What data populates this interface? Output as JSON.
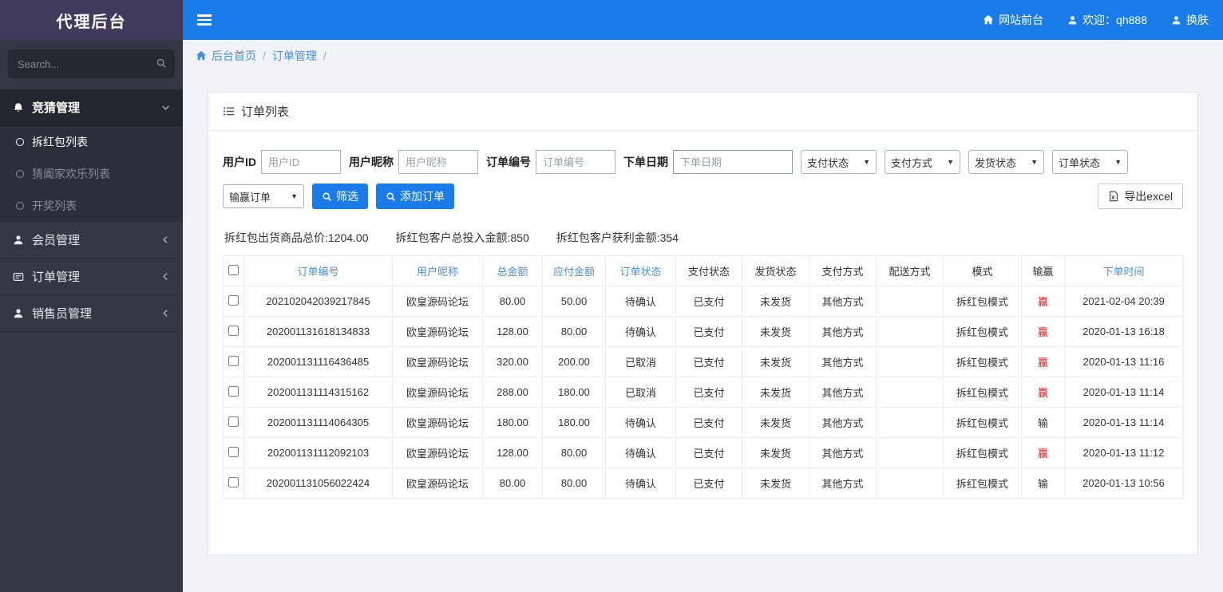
{
  "colors": {
    "accent": "#1a7ce8",
    "brand_bg": "#423a5c",
    "sidebar_bg": "#343845",
    "header_link": "#4a90d9",
    "win": "#e8161d"
  },
  "app": {
    "title": "代理后台"
  },
  "topbar": {
    "site_link": "网站前台",
    "welcome": "欢迎：qh888",
    "skin": "换肤"
  },
  "sidebar": {
    "search_placeholder": "Search...",
    "group": {
      "label": "竞猜管理"
    },
    "subitems": [
      {
        "label": "拆红包列表"
      },
      {
        "label": "猜阖家欢乐列表"
      },
      {
        "label": "开奖列表"
      }
    ],
    "items": [
      {
        "label": "会员管理"
      },
      {
        "label": "订单管理"
      },
      {
        "label": "销售员管理"
      }
    ]
  },
  "breadcrumb": {
    "home": "后台首页",
    "current": "订单管理",
    "separator": "/"
  },
  "panel": {
    "title": "订单列表",
    "filter": {
      "fields": [
        {
          "label": "用户ID",
          "placeholder": "用户ID"
        },
        {
          "label": "用户昵称",
          "placeholder": "用户昵称"
        },
        {
          "label": "订单编号",
          "placeholder": "订单编号"
        },
        {
          "label": "下单日期",
          "placeholder": "下单日期"
        }
      ],
      "selects": [
        "支付状态",
        "支付方式",
        "发货状态",
        "订单状态"
      ],
      "win_select": "输赢订单",
      "filter_btn": "筛选",
      "add_btn": "添加订单",
      "export_btn": "导出excel"
    },
    "stats": [
      "拆红包出货商品总价:1204.00",
      "拆红包客户总投入金额:850",
      "拆红包客户获利金额:354"
    ],
    "table": {
      "win_text": "赢",
      "lose_text": "输",
      "headers": [
        {
          "label": "订单编号",
          "link": true
        },
        {
          "label": "用户昵称",
          "link": true
        },
        {
          "label": "总金额",
          "link": true
        },
        {
          "label": "应付金额",
          "link": true
        },
        {
          "label": "订单状态",
          "link": true
        },
        {
          "label": "支付状态",
          "link": false
        },
        {
          "label": "发货状态",
          "link": false
        },
        {
          "label": "支付方式",
          "link": false
        },
        {
          "label": "配送方式",
          "link": false
        },
        {
          "label": "模式",
          "link": false
        },
        {
          "label": "输赢",
          "link": false
        },
        {
          "label": "下单时间",
          "link": true
        }
      ],
      "rows": [
        [
          "202102042039217845",
          "欧皇源码论坛",
          "80.00",
          "50.00",
          "待确认",
          "已支付",
          "未发货",
          "其他方式",
          "",
          "拆红包模式",
          "赢",
          "2021-02-04 20:39"
        ],
        [
          "202001131618134833",
          "欧皇源码论坛",
          "128.00",
          "80.00",
          "待确认",
          "已支付",
          "未发货",
          "其他方式",
          "",
          "拆红包模式",
          "赢",
          "2020-01-13 16:18"
        ],
        [
          "202001131116436485",
          "欧皇源码论坛",
          "320.00",
          "200.00",
          "已取消",
          "已支付",
          "未发货",
          "其他方式",
          "",
          "拆红包模式",
          "赢",
          "2020-01-13 11:16"
        ],
        [
          "202001131114315162",
          "欧皇源码论坛",
          "288.00",
          "180.00",
          "已取消",
          "已支付",
          "未发货",
          "其他方式",
          "",
          "拆红包模式",
          "赢",
          "2020-01-13 11:14"
        ],
        [
          "202001131114064305",
          "欧皇源码论坛",
          "180.00",
          "180.00",
          "待确认",
          "已支付",
          "未发货",
          "其他方式",
          "",
          "拆红包模式",
          "输",
          "2020-01-13 11:14"
        ],
        [
          "202001131112092103",
          "欧皇源码论坛",
          "128.00",
          "80.00",
          "待确认",
          "已支付",
          "未发货",
          "其他方式",
          "",
          "拆红包模式",
          "赢",
          "2020-01-13 11:12"
        ],
        [
          "202001131056022424",
          "欧皇源码论坛",
          "80.00",
          "80.00",
          "待确认",
          "已支付",
          "未发货",
          "其他方式",
          "",
          "拆红包模式",
          "输",
          "2020-01-13 10:56"
        ]
      ]
    }
  }
}
